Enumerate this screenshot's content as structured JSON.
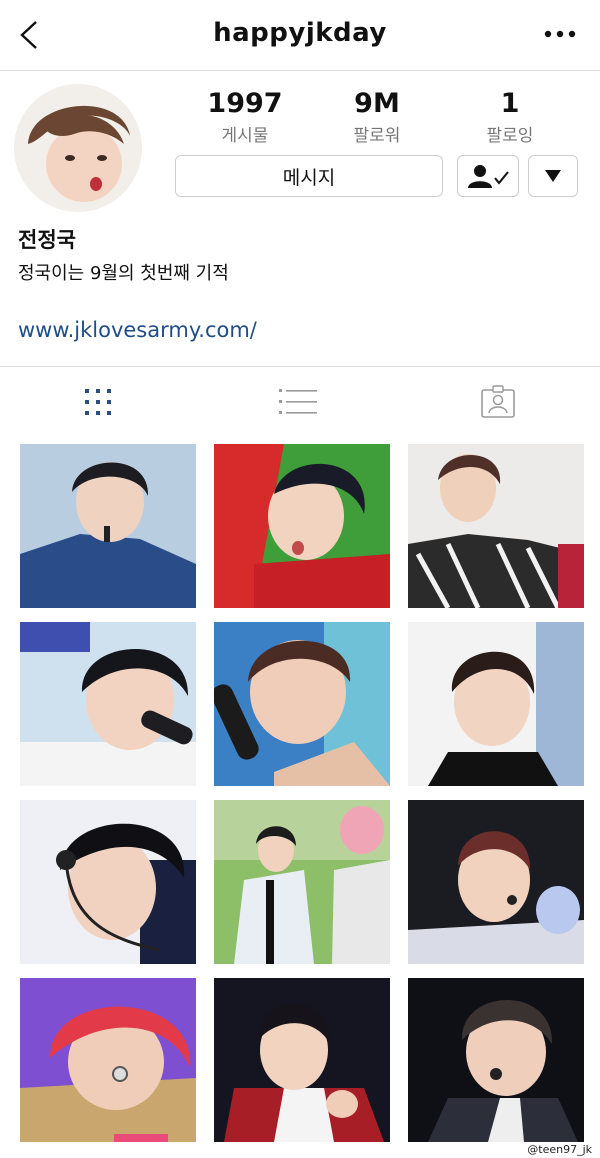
{
  "header": {
    "title": "happyjkday",
    "back_icon": "chevron-left-icon",
    "more_icon": "more-dots-icon"
  },
  "profile": {
    "stats": [
      {
        "value": "1997",
        "label": "게시물"
      },
      {
        "value": "9M",
        "label": "팔로워"
      },
      {
        "value": "1",
        "label": "팔로잉"
      }
    ],
    "message_label": "메시지",
    "name": "전정국",
    "bio": "정국이는 9월의 첫번째 기적",
    "link": "www.jklovesarmy.com/"
  },
  "tabs": [
    {
      "icon": "grid-icon",
      "active": true
    },
    {
      "icon": "list-icon",
      "active": false
    },
    {
      "icon": "tagged-icon",
      "active": false
    }
  ],
  "colors": {
    "active_tab": "#2b4f7d",
    "inactive_tab": "#9a9a9a",
    "link": "#1f4e87"
  },
  "watermark": "@teen97_jk"
}
